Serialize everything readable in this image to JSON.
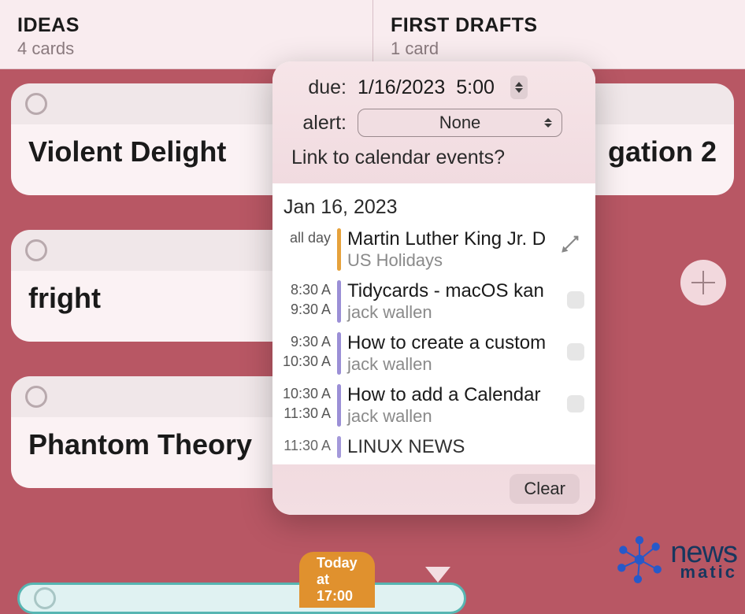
{
  "columns": [
    {
      "title": "IDEAS",
      "subtitle": "4 cards",
      "cards": [
        {
          "title": "Violent Delight"
        },
        {
          "title": "fright"
        },
        {
          "title": "Phantom Theory"
        }
      ]
    },
    {
      "title": "FIRST DRAFTS",
      "subtitle": "1 card",
      "cards": [
        {
          "title": "gation 2"
        }
      ]
    }
  ],
  "bottom_pill": "Today at 17:00",
  "popover": {
    "due_label": "due:",
    "due_date": "1/16/2023",
    "due_time": "5:00",
    "alert_label": "alert:",
    "alert_value": "None",
    "link_question": "Link to calendar events?",
    "events_date": "Jan 16, 2023",
    "events": [
      {
        "time_top": "all day",
        "time_bot": "",
        "bar": "orange",
        "title": "Martin Luther King Jr. D",
        "subtitle": "US Holidays",
        "locked": true,
        "checkbox": false
      },
      {
        "time_top": "8:30 A",
        "time_bot": "9:30 A",
        "bar": "purple",
        "title": "Tidycards - macOS kan",
        "subtitle": "jack wallen",
        "locked": false,
        "checkbox": true
      },
      {
        "time_top": "9:30 A",
        "time_bot": "10:30 A",
        "bar": "purple",
        "title": "How to create a custom",
        "subtitle": "jack wallen",
        "locked": false,
        "checkbox": true
      },
      {
        "time_top": "10:30 A",
        "time_bot": "11:30 A",
        "bar": "purple",
        "title": "How to add a Calendar",
        "subtitle": "jack wallen",
        "locked": false,
        "checkbox": true
      },
      {
        "time_top": "11:30 A",
        "time_bot": "",
        "bar": "purple",
        "title": "LINUX NEWS",
        "subtitle": "",
        "locked": false,
        "checkbox": false
      }
    ],
    "clear_label": "Clear"
  },
  "watermark": {
    "line1": "news",
    "line2": "matic"
  }
}
